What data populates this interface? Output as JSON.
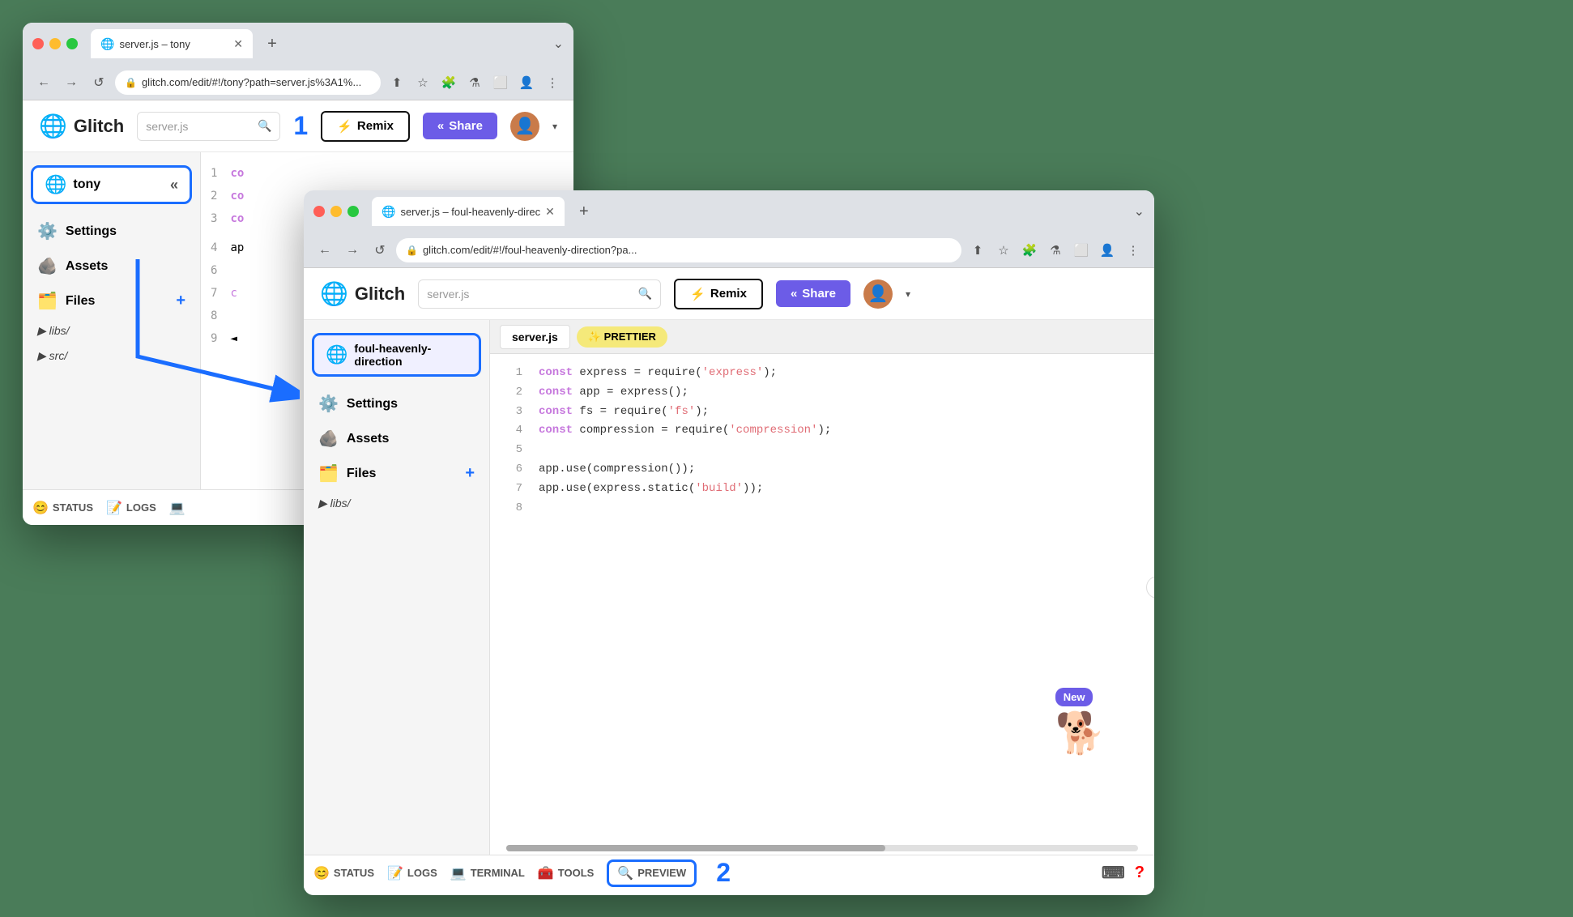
{
  "window_tony": {
    "tab_title": "server.js – tony",
    "tab_favicon": "🌐",
    "address": "glitch.com/edit/#!/tony?path=server.js%3A1%...",
    "logo": "Glitch",
    "search_placeholder": "server.js",
    "btn_remix": "Remix",
    "btn_share": "Share",
    "step1_label": "1",
    "project_name": "tony",
    "sidebar_items": [
      {
        "icon": "⚙️",
        "label": "Settings"
      },
      {
        "icon": "🪨",
        "label": "Assets"
      },
      {
        "icon": "🗂️",
        "label": "Files"
      }
    ],
    "folders": [
      "libs/",
      "src/"
    ],
    "status_items": [
      {
        "icon": "😊",
        "label": "STATUS"
      },
      {
        "icon": "📝",
        "label": "LOGS"
      },
      {
        "icon": "💻",
        "label": ""
      }
    ],
    "code_lines": [
      {
        "num": "1",
        "text": "co"
      },
      {
        "num": "2",
        "text": "co"
      },
      {
        "num": "3",
        "text": "co"
      }
    ]
  },
  "window_foul": {
    "tab_title": "server.js – foul-heavenly-direc",
    "tab_favicon": "🌐",
    "address": "glitch.com/edit/#!/foul-heavenly-direction?pa...",
    "logo": "Glitch",
    "search_placeholder": "server.js",
    "btn_remix": "Remix",
    "btn_share": "Share",
    "project_name": "foul-heavenly-direction",
    "sidebar_items": [
      {
        "icon": "⚙️",
        "label": "Settings"
      },
      {
        "icon": "🪨",
        "label": "Assets"
      },
      {
        "icon": "🗂️",
        "label": "Files"
      }
    ],
    "folders": [
      "libs/"
    ],
    "editor_tab": "server.js",
    "prettier_label": "✨ PRETTIER",
    "code_lines": [
      {
        "num": "1",
        "kw": "const",
        "rest": " express = require(",
        "str": "'express'",
        "end": ");"
      },
      {
        "num": "2",
        "kw": "const",
        "rest": " app = express();"
      },
      {
        "num": "3",
        "kw": "const",
        "rest": " fs = require(",
        "str": "'fs'",
        "end": ");"
      },
      {
        "num": "4",
        "kw": "const",
        "rest": " compression = require(",
        "str": "'compression'",
        "end": ");"
      },
      {
        "num": "5",
        "text": ""
      },
      {
        "num": "6",
        "text": "app.use(compression());"
      },
      {
        "num": "7",
        "text": "app.use(express.static(",
        "str": "'build'",
        "end": "));"
      },
      {
        "num": "8",
        "text": ""
      }
    ],
    "status_items": [
      {
        "icon": "😊",
        "label": "STATUS"
      },
      {
        "icon": "📝",
        "label": "LOGS"
      },
      {
        "icon": "💻",
        "label": "TERMINAL"
      },
      {
        "icon": "🧰",
        "label": "TOOLS"
      },
      {
        "icon": "🔍",
        "label": "PREVIEW"
      }
    ],
    "step2_label": "2",
    "new_badge": "New"
  },
  "icons": {
    "back": "←",
    "forward": "→",
    "refresh": "↺",
    "lock": "🔒",
    "share_url": "⬆",
    "star": "☆",
    "puzzle": "🧩",
    "flask": "⚗",
    "window": "⬜",
    "person": "👤",
    "more": "⋮",
    "collapse": "«",
    "add": "+",
    "lightning": "⚡",
    "share": "«"
  }
}
